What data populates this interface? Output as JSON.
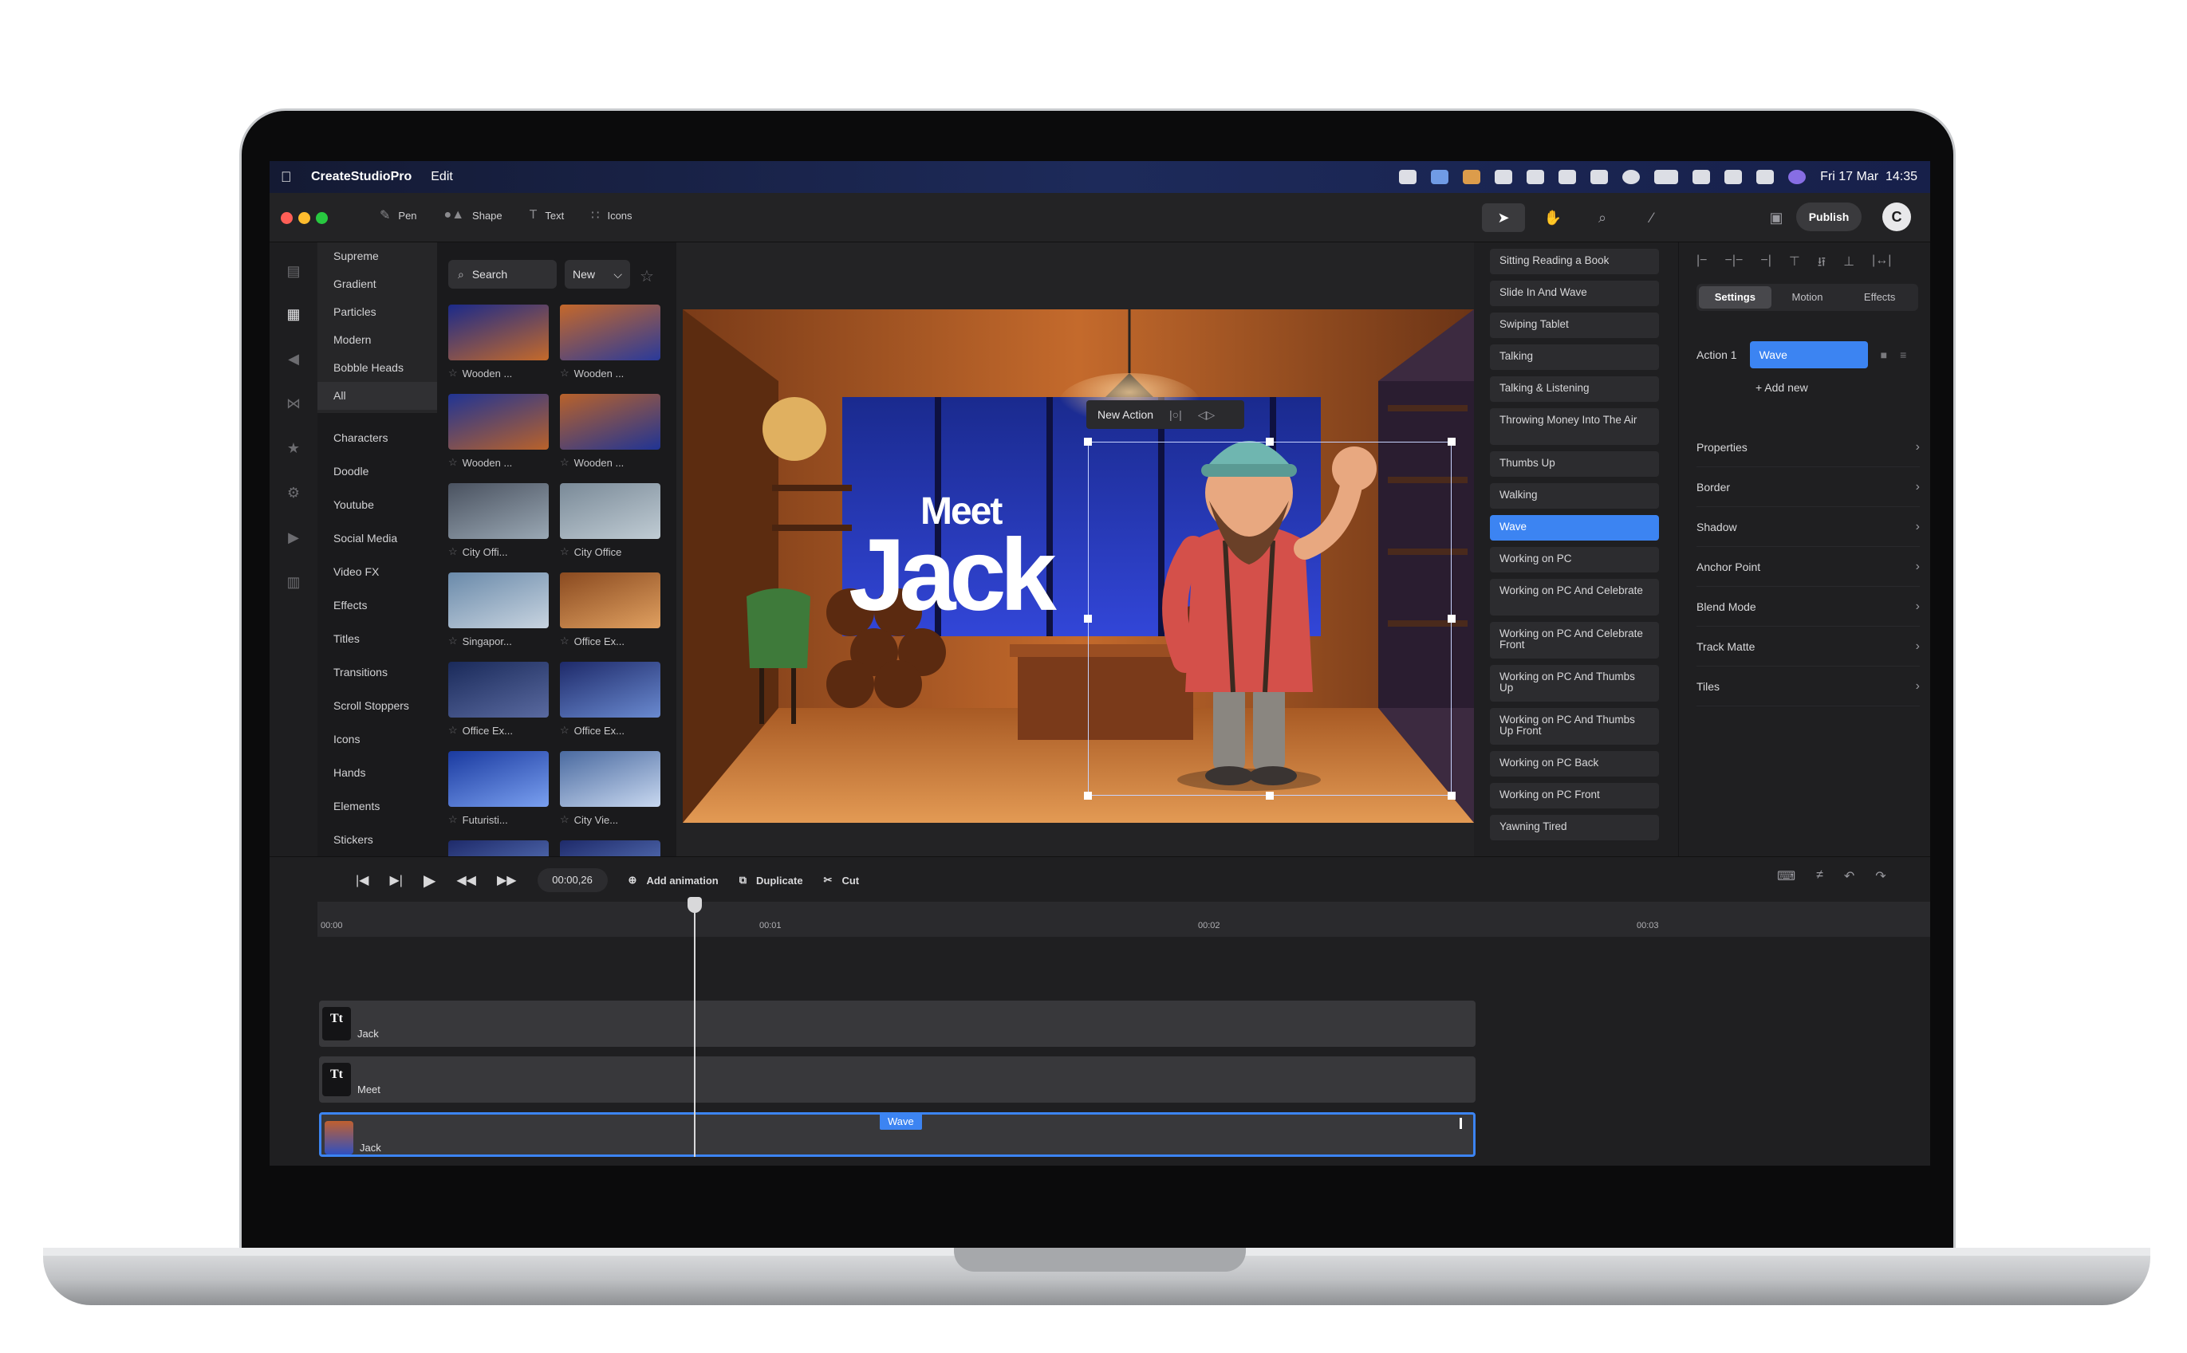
{
  "menubar": {
    "app_name": "CreateStudioPro",
    "edit": "Edit",
    "datetime": "Fri 17 Mar  14:35"
  },
  "toolbar": {
    "pen": "Pen",
    "shape": "Shape",
    "text": "Text",
    "icons": "Icons",
    "publish": "Publish"
  },
  "subcategories": [
    "Supreme",
    "Gradient",
    "Particles",
    "Modern",
    "Bobble Heads",
    "All"
  ],
  "categories": [
    "Characters",
    "Doodle",
    "Youtube",
    "Social Media",
    "Video FX",
    "Effects",
    "Titles",
    "Transitions",
    "Scroll Stoppers",
    "Icons",
    "Hands",
    "Elements",
    "Stickers"
  ],
  "assets": {
    "search": "Search",
    "filter": "New",
    "items": [
      "Wooden ...",
      "Wooden ...",
      "Wooden ...",
      "Wooden ...",
      "City Offi...",
      "City Office",
      "Singapor...",
      "Office Ex...",
      "Office Ex...",
      "Office Ex...",
      "Futuristi...",
      "City Vie..."
    ]
  },
  "canvas": {
    "line1": "Meet",
    "line2": "Jack",
    "new_action": "New Action"
  },
  "actions": [
    "Sitting Reading a Book",
    "Slide In And Wave",
    "Swiping Tablet",
    "Talking",
    "Talking & Listening",
    "Throwing Money Into The Air",
    "Thumbs Up",
    "Walking",
    "Wave",
    "Working on PC",
    "Working on PC And Celebrate",
    "Working on PC And Celebrate Front",
    "Working on PC And Thumbs Up",
    "Working on PC And Thumbs Up Front",
    "Working on PC Back",
    "Working on PC Front",
    "Yawning Tired"
  ],
  "selected_action": "Wave",
  "props": {
    "tabs": [
      "Settings",
      "Motion",
      "Effects"
    ],
    "action_label": "Action 1",
    "action_value": "Wave",
    "add_new": "+ Add new",
    "sections": [
      "Properties",
      "Border",
      "Shadow",
      "Anchor Point",
      "Blend Mode",
      "Track Matte",
      "Tiles"
    ]
  },
  "timeline": {
    "timecode": "00:00,26",
    "add_animation": "Add animation",
    "duplicate": "Duplicate",
    "cut": "Cut",
    "ticks": [
      "00:00",
      "00:01",
      "00:02",
      "00:03"
    ],
    "tracks": [
      {
        "badge": "Tt",
        "name": "Jack"
      },
      {
        "badge": "Tt",
        "name": "Meet"
      },
      {
        "badge": "",
        "name": "Jack"
      }
    ],
    "clip_label": "Wave"
  },
  "colors": {
    "accent": "#3c84f2"
  }
}
